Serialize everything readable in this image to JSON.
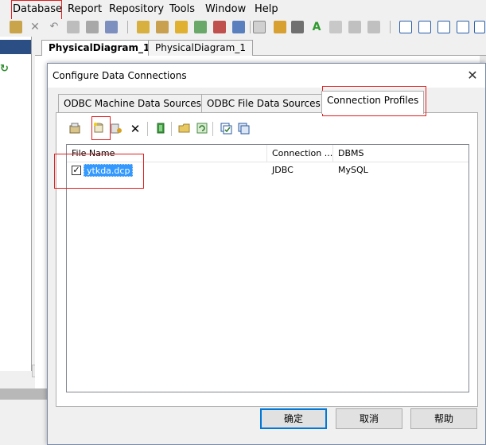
{
  "menubar": {
    "items": [
      "Database",
      "Report",
      "Repository",
      "Tools",
      "Window",
      "Help"
    ]
  },
  "doc_tabs": [
    "PhysicalDiagram_1",
    "PhysicalDiagram_1"
  ],
  "dialog": {
    "title": "Configure Data Connections",
    "close_symbol": "✕",
    "tabs": [
      "ODBC Machine Data Sources",
      "ODBC File Data Sources",
      "Connection Profiles"
    ],
    "active_tab": "Connection Profiles",
    "toolbar_icons": [
      "properties-icon",
      "new-profile-icon",
      "add-profile-icon",
      "delete-icon",
      "test-connection-icon",
      "open-folder-icon",
      "refresh-icon",
      "check-all-icon",
      "copy-icon"
    ],
    "list": {
      "columns": [
        "File Name",
        "Connection ...",
        "DBMS"
      ],
      "rows": [
        {
          "checked": true,
          "file_name": "ytkda.dcp",
          "connection": "JDBC",
          "dbms": "MySQL"
        }
      ]
    },
    "buttons": {
      "ok": "确定",
      "cancel": "取消",
      "help": "帮助"
    }
  },
  "colors": {
    "annotation_red": "#e02020",
    "selection_blue": "#3399ff",
    "default_button_border": "#0078d7"
  }
}
